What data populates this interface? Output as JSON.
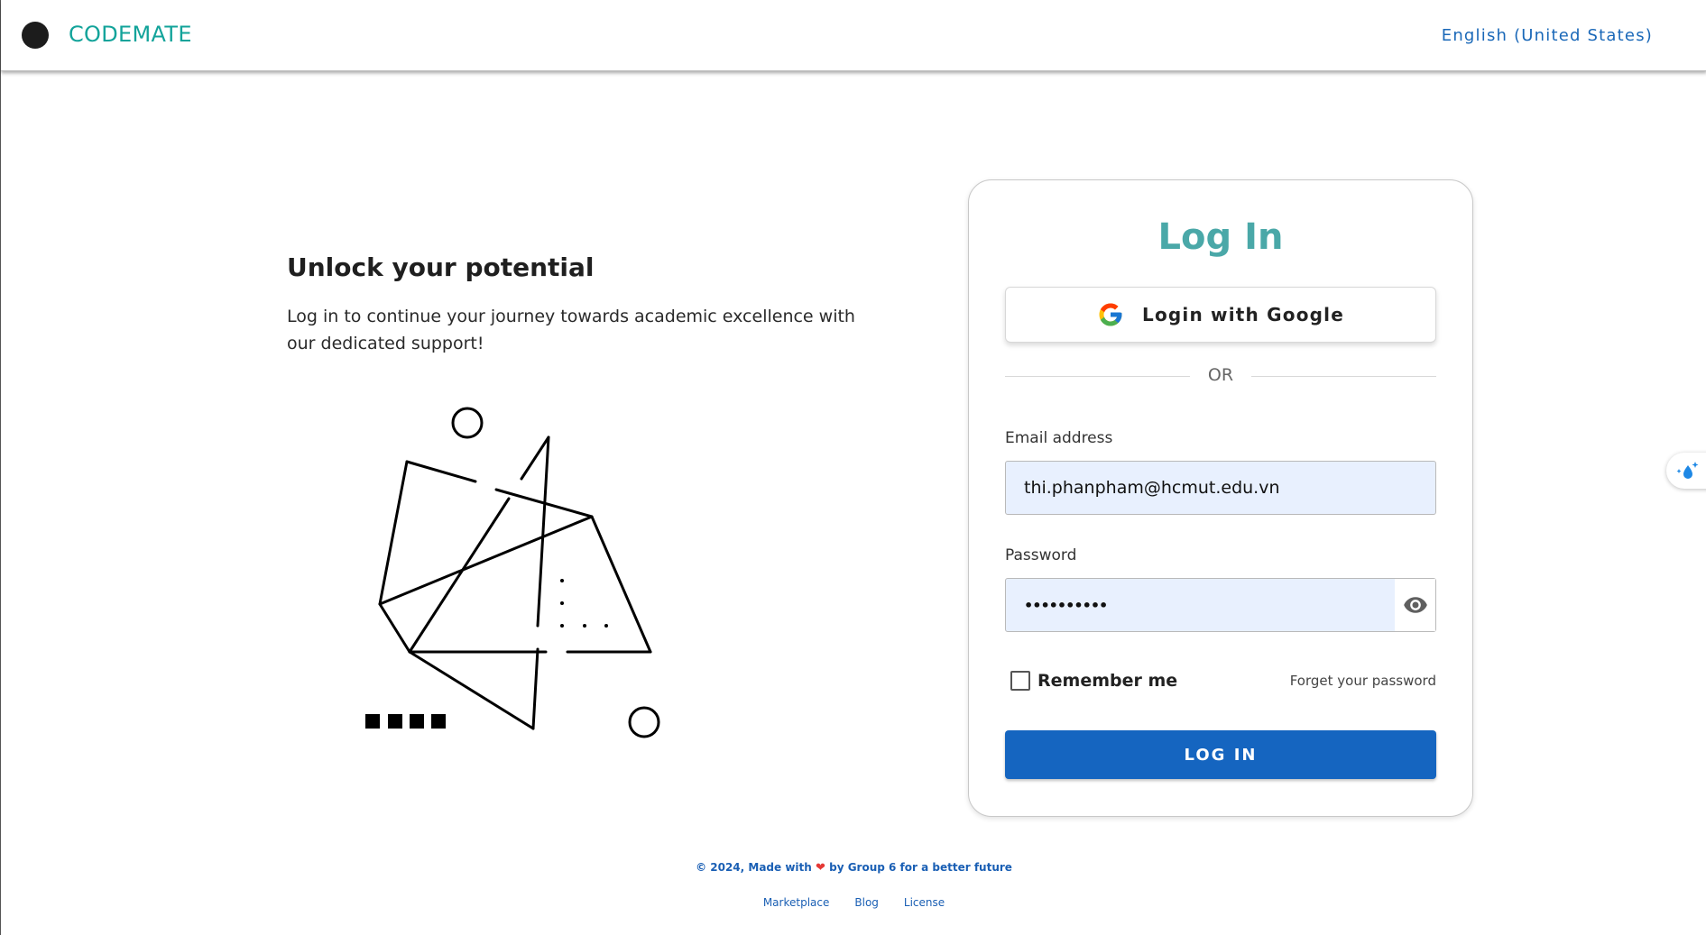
{
  "header": {
    "brand": "CODEMATE",
    "language": "English (United States)"
  },
  "hero": {
    "title": "Unlock your potential",
    "text": "Log in to continue your journey towards academic excellence with our dedicated support!"
  },
  "login": {
    "title": "Log In",
    "google_label": "Login with Google",
    "or_text": "OR",
    "email_label": "Email address",
    "email_value": "thi.phanpham@hcmut.edu.vn",
    "password_label": "Password",
    "password_masked": "••••••••••",
    "remember_label": "Remember me",
    "forgot_label": "Forget your password",
    "submit_label": "LOG IN"
  },
  "footer": {
    "credit_prefix": "© 2024, Made with",
    "credit_suffix": "by Group 6 for a better future",
    "links": [
      "Marketplace",
      "Blog",
      "License"
    ]
  },
  "icons": {
    "logo": "logo-dot-icon",
    "google": "google-icon",
    "eye": "eye-icon",
    "heart": "heart-icon",
    "widget": "droplet-sparkle-icon"
  },
  "colors": {
    "brand": "#12a39a",
    "title_teal": "#4aa8a8",
    "primary_button": "#1565c0",
    "link_blue": "#1a5fb4",
    "input_bg": "#e8f0fe"
  }
}
